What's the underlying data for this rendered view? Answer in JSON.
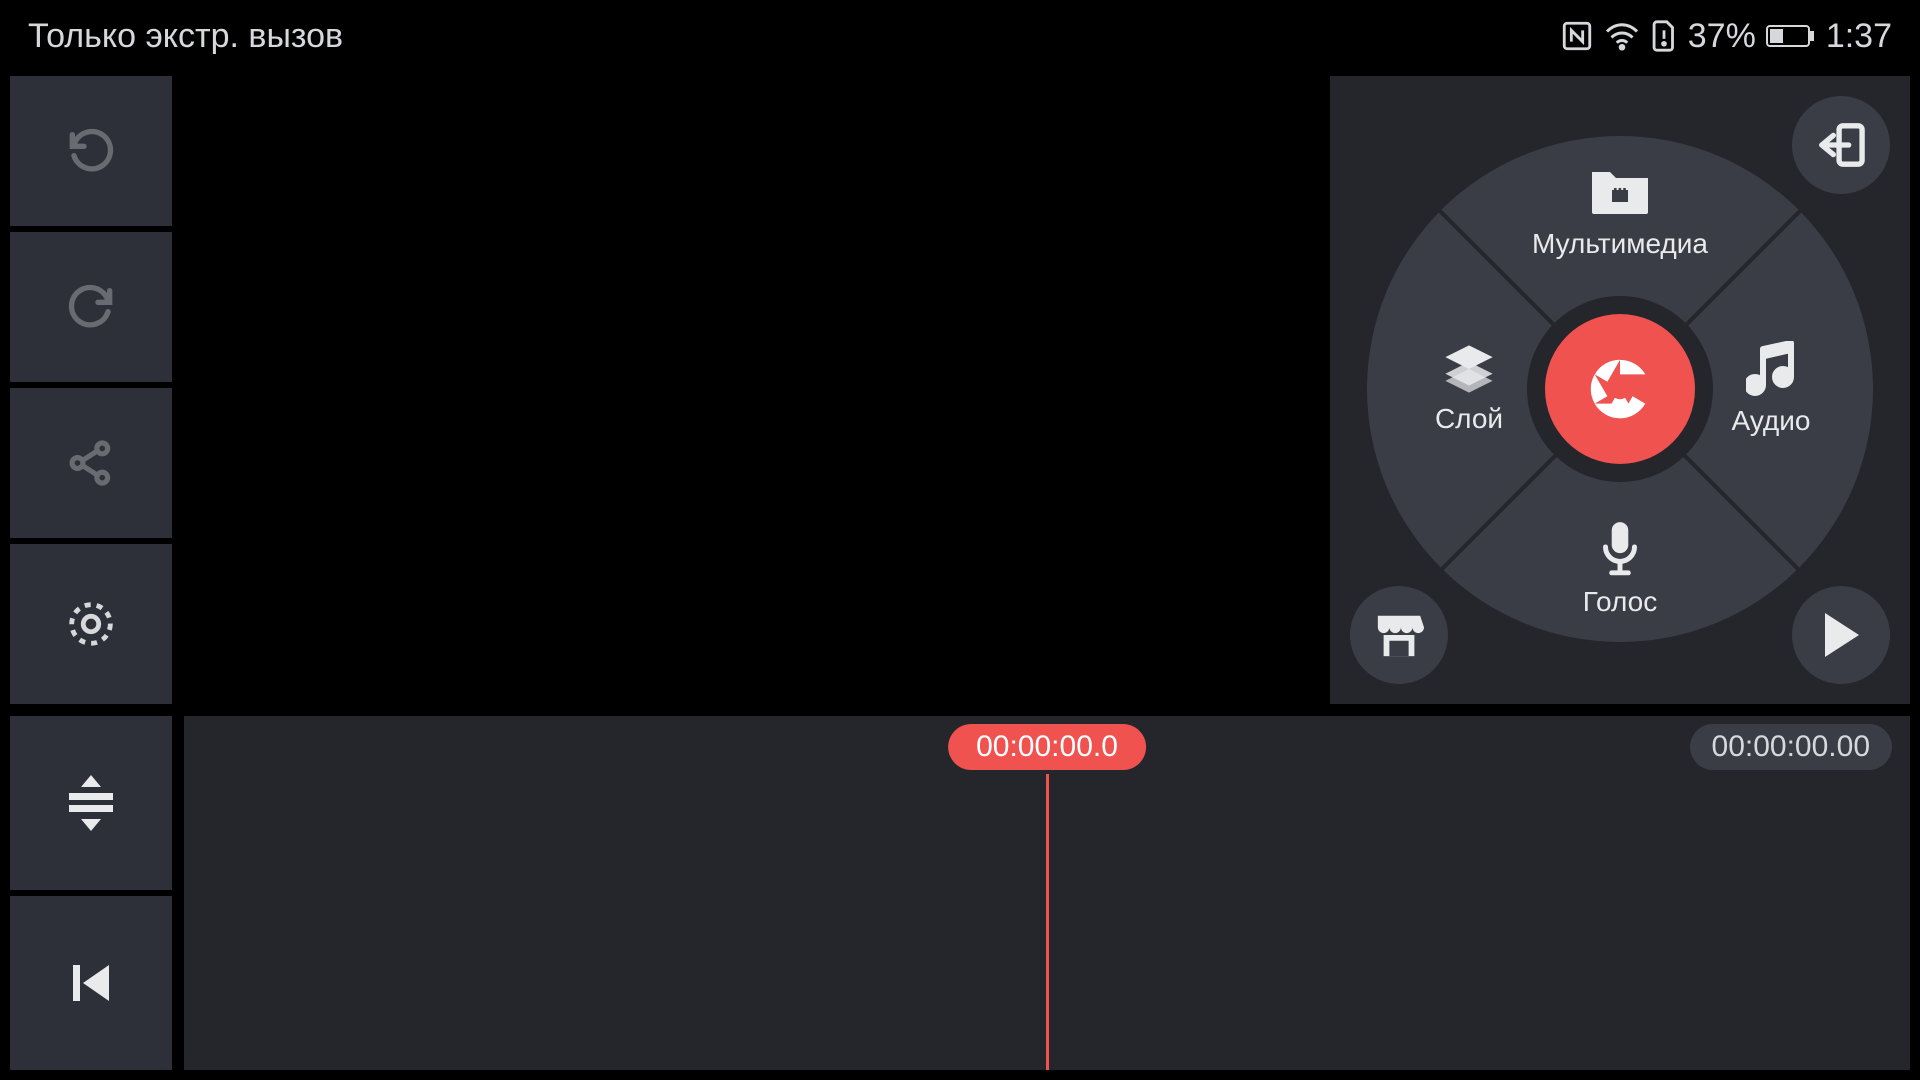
{
  "status_bar": {
    "carrier": "Только экстр. вызов",
    "battery_pct": "37%",
    "clock": "1:37"
  },
  "sidebar": {
    "undo": "undo",
    "redo": "redo",
    "share": "share",
    "settings": "settings"
  },
  "wheel": {
    "top": {
      "label": "Мультимедиа"
    },
    "left": {
      "label": "Слой"
    },
    "right": {
      "label": "Аудио"
    },
    "bottom": {
      "label": "Голос"
    },
    "center": "capture"
  },
  "corners": {
    "exit": "exit",
    "store": "store",
    "play": "play"
  },
  "timeline": {
    "playhead": "00:00:00.0",
    "total": "00:00:00.00"
  },
  "colors": {
    "accent": "#f0524f",
    "panel": "#24262c",
    "button": "#3a3d45"
  }
}
